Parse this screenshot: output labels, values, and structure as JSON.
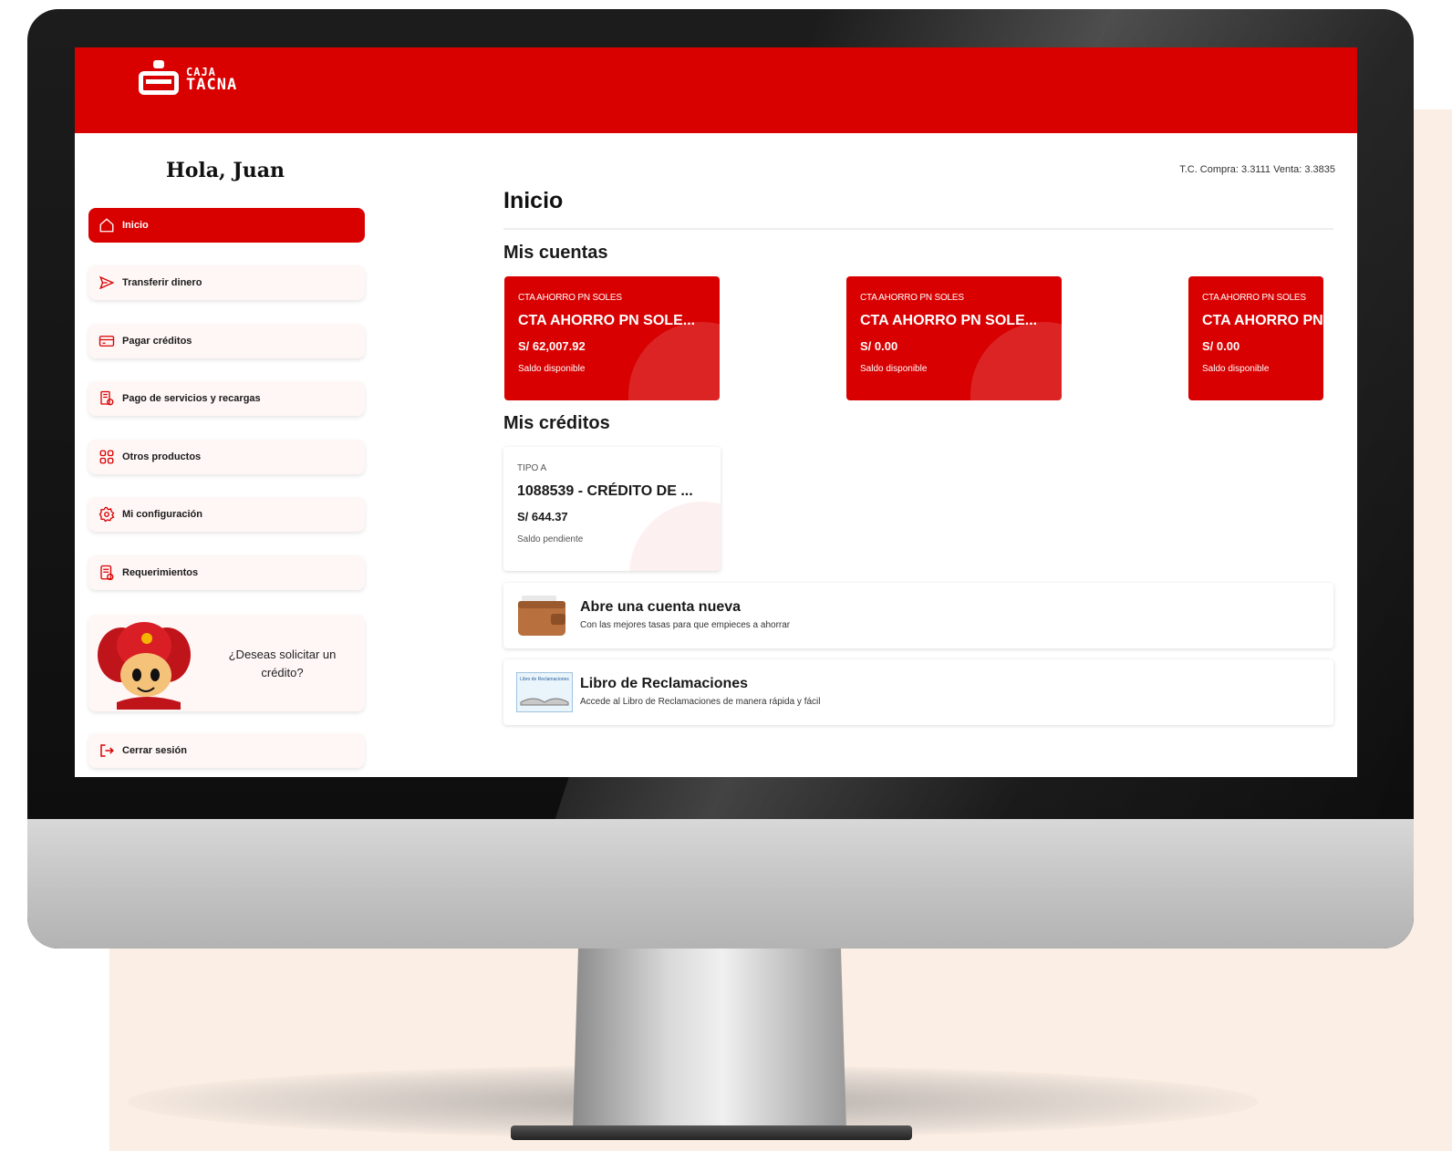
{
  "app": {
    "brand_line1": "CAJA",
    "brand_line2": "TACNA",
    "brand_color": "#d90000"
  },
  "sidebar": {
    "greeting": "Hola, Juan",
    "items": [
      {
        "label": "Inicio",
        "icon": "home-icon",
        "active": true
      },
      {
        "label": "Transferir dinero",
        "icon": "send-icon"
      },
      {
        "label": "Pagar créditos",
        "icon": "credit-card-icon"
      },
      {
        "label": "Pago de servicios y recargas",
        "icon": "receipt-icon"
      },
      {
        "label": "Otros productos",
        "icon": "grid-icon"
      },
      {
        "label": "Mi configuración",
        "icon": "gear-icon"
      },
      {
        "label": "Requerimientos",
        "icon": "document-icon"
      }
    ],
    "promo_text": "¿Deseas solicitar un crédito?",
    "logout_label": "Cerrar sesión"
  },
  "main": {
    "exchange_rate": "T.C. Compra: 3.3111 Venta: 3.3835",
    "title": "Inicio",
    "accounts_title": "Mis cuentas",
    "accounts": [
      {
        "type": "CTA AHORRO PN SOLES",
        "name": "CTA AHORRO PN SOLE...",
        "amount": "S/ 62,007.92",
        "label": "Saldo disponible"
      },
      {
        "type": "CTA AHORRO PN SOLES",
        "name": "CTA AHORRO PN SOLE...",
        "amount": "S/ 0.00",
        "label": "Saldo disponible"
      },
      {
        "type": "CTA AHORRO PN SOLES",
        "name": "CTA AHORRO PN SOLE...",
        "amount": "S/ 0.00",
        "label": "Saldo disponible"
      }
    ],
    "credits_title": "Mis créditos",
    "credits": [
      {
        "type": "TIPO A",
        "name": "1088539 - CRÉDITO DE ...",
        "amount": "S/ 644.37",
        "label": "Saldo pendiente"
      }
    ],
    "banners": [
      {
        "title": "Abre una cuenta nueva",
        "subtitle": "Con las mejores tasas para que empieces a ahorrar",
        "icon": "wallet-icon"
      },
      {
        "title": "Libro de Reclamaciones",
        "subtitle": "Accede al Libro de Reclamaciones de manera rápida y fácil",
        "icon": "book-icon",
        "icon_caption": "Libro de Reclamaciones"
      }
    ]
  }
}
